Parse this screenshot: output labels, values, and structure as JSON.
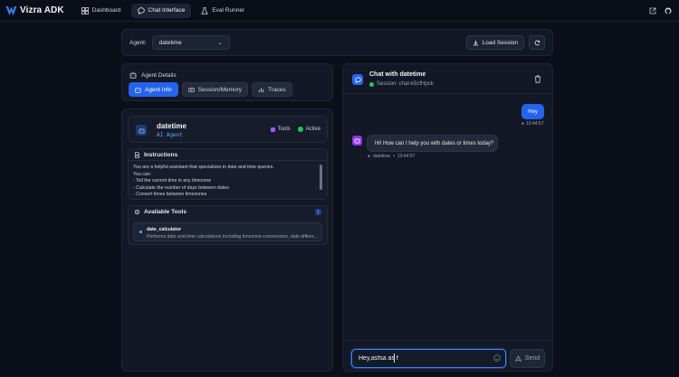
{
  "app": {
    "name": "Vizra ADK"
  },
  "nav": [
    {
      "label": "Dashboard",
      "icon": "grid-icon",
      "active": false
    },
    {
      "label": "Chat Interface",
      "icon": "chat-bubble-icon",
      "active": true
    },
    {
      "label": "Eval Runner",
      "icon": "flask-icon",
      "active": false
    }
  ],
  "agent_bar": {
    "label": "Agent:",
    "selected_agent": "datetime",
    "load_session_label": "Load Session"
  },
  "details": {
    "title": "Agent Details",
    "tabs": [
      {
        "label": "Agent Info",
        "active": true
      },
      {
        "label": "Session/Memory",
        "active": false
      },
      {
        "label": "Traces",
        "active": false
      }
    ]
  },
  "agent_card": {
    "name": "datetime",
    "type": "AI Agent",
    "tools_badge": "Tools",
    "status_badge": "Active"
  },
  "instructions": {
    "title": "Instructions",
    "lines": [
      "You are a helpful assistant that specializes in date and time queries.",
      "You can:",
      "- Tell the current time in any timezone",
      "- Calculate the number of days between dates",
      "- Convert times between timezones"
    ]
  },
  "tools": {
    "title": "Available Tools",
    "count": "1",
    "items": [
      {
        "name": "date_calculator",
        "description": "Performs date and time calculations including timezone conversions, date differe..."
      }
    ]
  },
  "chat": {
    "title": "Chat with datetime",
    "session": "Session: chat-k5cfHpck",
    "messages": [
      {
        "role": "user",
        "text": "Hey",
        "time": "10:44:57"
      },
      {
        "role": "agent",
        "text": "Hi! How can I help you with dates or times today?",
        "sender": "datetime",
        "time": "10:44:57"
      }
    ],
    "input_value": "Hey,asfsa as f",
    "send_label": "Send"
  },
  "colors": {
    "accent": "#2563eb",
    "background": "#0b0f19",
    "panel": "#121826",
    "agent_avatar": "#9333ea",
    "active_status": "#22c55e"
  }
}
